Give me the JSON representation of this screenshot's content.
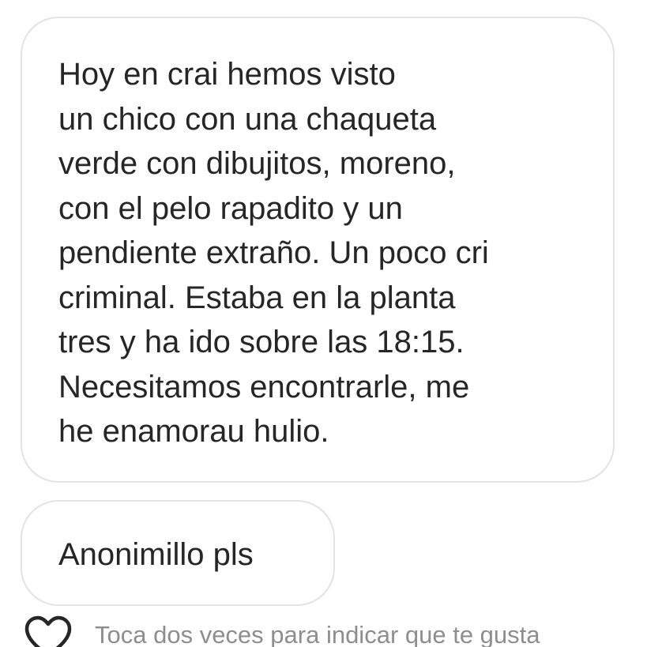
{
  "messages": [
    {
      "text": "Hoy en crai hemos visto\nun chico con una chaqueta\nverde con dibujitos, moreno,\ncon el pelo rapadito y un\npendiente extraño. Un poco cri\ncriminal. Estaba en la planta\ntres y ha ido sobre las 18:15.\nNecesitamos encontrarle, me\nhe enamorau hulio."
    },
    {
      "text": "Anonimillo pls"
    }
  ],
  "footer": {
    "like_icon": "heart-outline-icon",
    "hint": "Toca dos veces para indicar que te gusta"
  },
  "colors": {
    "bubble_border": "#e3e3e3",
    "message_text": "#262626",
    "hint_text": "#8e8e8e"
  }
}
